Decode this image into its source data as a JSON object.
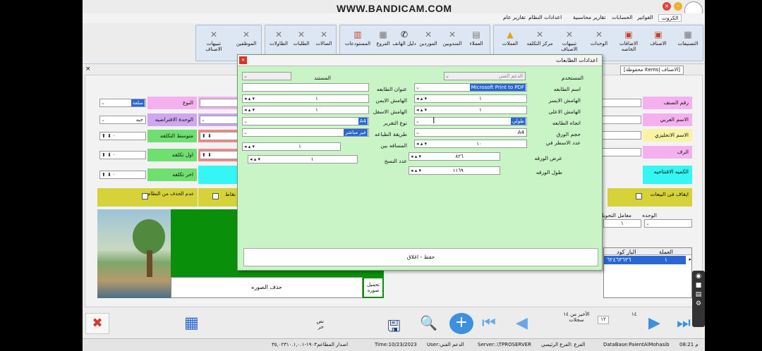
{
  "watermark": "WWW.BANDICAM.COM",
  "menu": {
    "items": [
      "الكروت",
      "الفواتير",
      "الحسابات",
      "تقارير محاسبية",
      "اعدادات النظام",
      "تقارير عام"
    ],
    "active": "الكروت"
  },
  "ribbon": {
    "group1": [
      "التصنيفات",
      "الاصناف",
      "الاضافات الخاصه",
      "الوحدات",
      "تنبيهات الاصناف",
      "مركز التكلفه",
      "العملات"
    ],
    "group2": [
      "العملاء",
      "المندوبين",
      "الموردين",
      "دليل الهاتف",
      "الفروع",
      "المستودعات"
    ],
    "group3": [
      "الصالات",
      "الطلبات",
      "الطاولات"
    ],
    "group4": [
      "الموظفين",
      "تنبيهات الاصناف"
    ]
  },
  "doc_tab": "[الاصناف |Items محفوظة]",
  "form": {
    "right": {
      "item_no": "رقم الصنف",
      "name_ar": "الاسم العربي",
      "name_en": "الاسم الانجليزي",
      "barcode": "الرف",
      "default_qty": "الكميه الافتتاحيه",
      "stop_sales": "ايقاف فى البيعات",
      "unit": "الوحده",
      "conversion": "معامل التحويل",
      "conversion_value": "١",
      "table_headers": [
        "العملة",
        "البار كود"
      ],
      "table_row": [
        "١",
        "٦٢٤٦٣٦٣٦"
      ]
    },
    "left": {
      "type": "النوع",
      "type_value": "سلعة",
      "def_unit": "الوحدة الافتراضيه",
      "def_unit_value": "حبه",
      "avg_cost": "متوسط التكلفه",
      "first_cost": "اول تكلفه",
      "last_cost": "اخر تكلفه",
      "no_delete": "عدم الحذف من النظام",
      "points": "نقاط",
      "delete_image": "حذف الصوره",
      "load_image": "تحميل صوره"
    }
  },
  "dialog": {
    "title": "اعدادات الطابعات",
    "user_label": "المستخدم",
    "user_value": "الدعم الفني",
    "doc_label": "المستند",
    "printer_label": "اسم الطابعه",
    "printer_value": "Microsoft Print to PDF",
    "title_label": "عنوان الطابعه",
    "right_margin": "الهامش الايسر",
    "right_margin_value": "١",
    "top_margin": "الهامش الاعلى",
    "top_margin_value": "١",
    "left_margin": "الهامش الايمن",
    "left_margin_value": "١",
    "bottom_margin": "الهامش الاسفل",
    "bottom_margin_value": "١",
    "orientation": "اتجاه الطابعه",
    "orientation_value": "طولي",
    "report_type": "نوع التقرير",
    "report_type_value": "A4",
    "paper_size": "حجم الورق",
    "paper_size_value": "A4",
    "print_method": "طريقة الطباعه",
    "print_method_value": "غير مباشر",
    "rows_count": "عدد الاسطر في",
    "rows_count_value": "١٠",
    "spacing": "المسافه بين",
    "spacing_value": "١",
    "copies": "عدد النسخ",
    "copies_value": "١",
    "paper_width": "عرض الورقه",
    "paper_width_value": "٨٢٦",
    "paper_length": "طول الورقه",
    "paper_length_value": "١١٦٩",
    "save": "حفظ - اغلاق"
  },
  "nav": {
    "record_of": "الأخير من ١٤ سجلات",
    "current": "١٢",
    "total": "١٤",
    "extra_label": "نص حر"
  },
  "status": {
    "time": "م 08:21",
    "database": "DataBase:PaientAlMohasib",
    "branch": "الفرع :الفرع الرئيسي",
    "server": "Server:.\\TPROSERVER",
    "user": "User:الدعم الفني",
    "date": "Time:10/23/2023",
    "version": "اصدار المطاعم١٩٠٣-٣٥,٠٢٣١٠.١,٠.١"
  }
}
